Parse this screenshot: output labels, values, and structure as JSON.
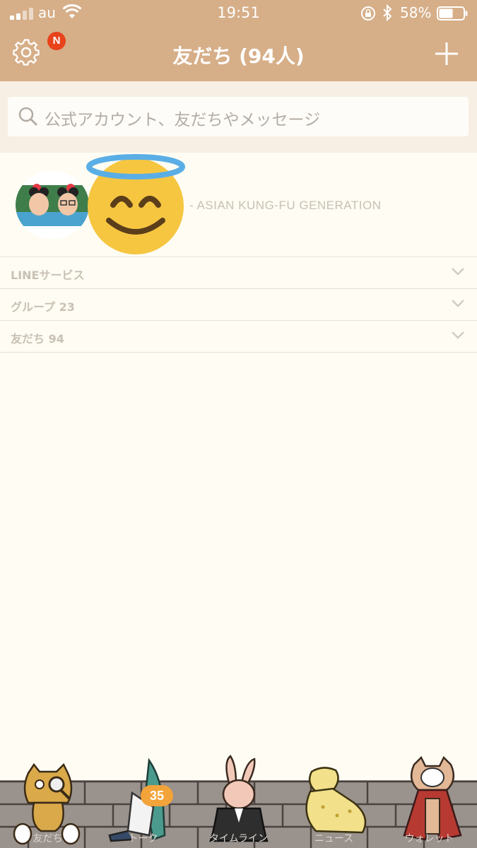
{
  "status_bar": {
    "carrier": "au",
    "time": "19:51",
    "battery_percent": "58%",
    "battery_level": 0.58
  },
  "header": {
    "title": "友だち (94人)",
    "settings_badge": "N"
  },
  "search": {
    "placeholder": "公式アカウント、友だちやメッセージ"
  },
  "profile": {
    "status_message": "- ASIAN KUNG-FU GENERATION"
  },
  "sections": [
    {
      "label": "LINEサービス"
    },
    {
      "label": "グループ 23"
    },
    {
      "label": "友だち 94"
    }
  ],
  "tabs": [
    {
      "label": "友だち"
    },
    {
      "label": "トーク",
      "badge": "35"
    },
    {
      "label": "タイムライン"
    },
    {
      "label": "ニュース"
    },
    {
      "label": "ウォレット"
    }
  ],
  "colors": {
    "header_bg": "#d6ae88",
    "badge_red": "#e8431b",
    "badge_orange": "#f2a33a",
    "background": "#fefcf3"
  }
}
